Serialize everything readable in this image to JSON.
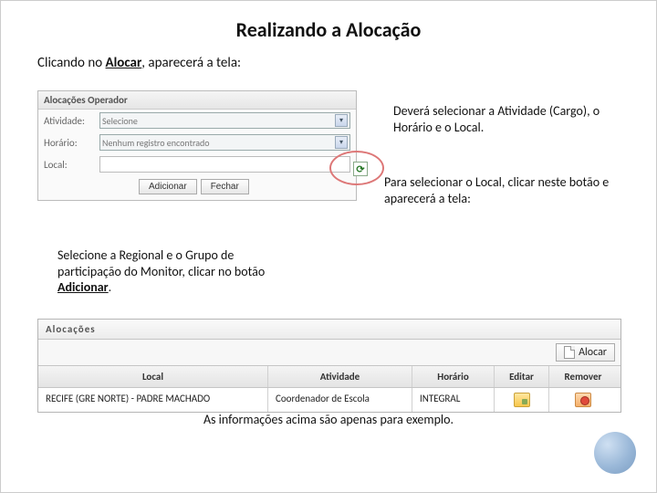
{
  "title": "Realizando a Alocação",
  "subtitle_pre": "Clicando no ",
  "subtitle_bold": "Alocar",
  "subtitle_post": ", aparecerá a tela:",
  "form": {
    "header": "Alocações Operador",
    "labels": {
      "atividade": "Atividade:",
      "horario": "Horário:",
      "local": "Local:"
    },
    "atividade_value": "Selecione",
    "horario_value": "Nenhum registro encontrado",
    "buttons": {
      "adicionar": "Adicionar",
      "fechar": "Fechar"
    }
  },
  "callouts": {
    "c1": "Deverá selecionar a Atividade (Cargo), o Horário e o Local.",
    "c2": "Para selecionar o Local, clicar neste botão e aparecerá a tela:",
    "c3_pre": "Selecione a Regional e o Grupo de participação do Monitor, clicar no botão ",
    "c3_bold": "Adicionar",
    "c3_post": "."
  },
  "table": {
    "title": "Alocações",
    "alocar": "Alocar",
    "headers": {
      "local": "Local",
      "atividade": "Atividade",
      "horario": "Horário",
      "editar": "Editar",
      "remover": "Remover"
    },
    "row": {
      "local": "RECIFE (GRE NORTE) - PADRE MACHADO",
      "atividade": "Coordenador de Escola",
      "horario": "INTEGRAL"
    }
  },
  "footnote": "As informações acima são apenas para exemplo."
}
